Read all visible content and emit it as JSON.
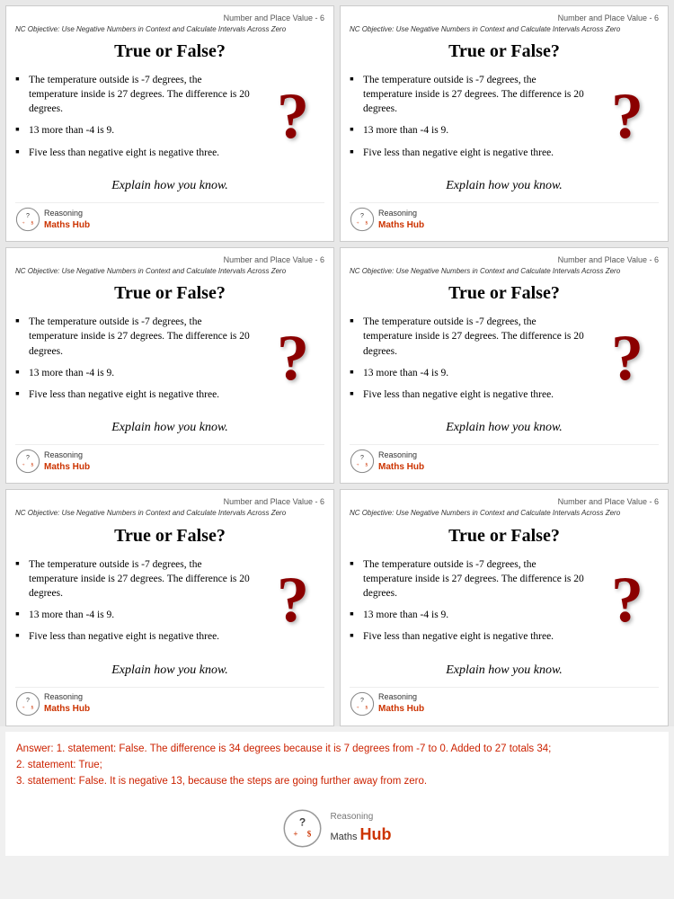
{
  "header_label": "Number and Place Value - 6",
  "nc_objective": "NC Objective: Use Negative Numbers in Context and Calculate Intervals Across Zero",
  "card_title": "True or False?",
  "statements": [
    "The temperature outside is -7 degrees, the temperature inside is 27 degrees. The difference is 20 degrees.",
    "13 more than -4 is 9.",
    "Five less than negative eight is negative three."
  ],
  "explain_text": "Explain how you know.",
  "logo_reasoning": "Reasoning",
  "logo_maths_hub": "Maths Hub",
  "answer_label": "Answer:",
  "answer_text": "Answer: 1. statement: False. The difference is 34 degrees because it is 7 degrees from -7 to 0. Added to 27 totals 34;\n2. statement: True;\n3. statement: False. It is negative 13, because the steps are going further away from zero.",
  "footer_reasoning": "Reasoning",
  "footer_maths_hub": "Maths Hub"
}
